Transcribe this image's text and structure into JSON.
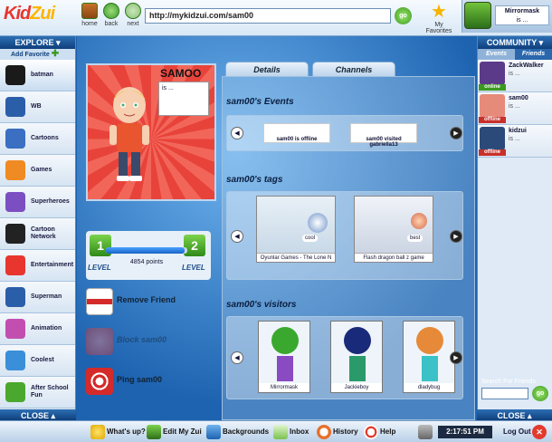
{
  "app": {
    "logo_a": "Kid",
    "logo_b": "Zui"
  },
  "nav": {
    "home": "home",
    "back": "back",
    "next": "next"
  },
  "url": "http://mykidzui.com/sam00",
  "go": "go",
  "favorites": "My Favorites",
  "user": {
    "name": "Mirrormask",
    "status": "is ..."
  },
  "explore": {
    "title": "EXPLORE",
    "add_favorite": "Add Favorite",
    "items": [
      {
        "label": "batman",
        "color": "#1a1a1a"
      },
      {
        "label": "WB",
        "color": "#2b5ea8"
      },
      {
        "label": "Cartoons",
        "color": "#3a6fc2"
      },
      {
        "label": "Games",
        "color": "#f08a22"
      },
      {
        "label": "Superheroes",
        "color": "#7b4fc2"
      },
      {
        "label": "Cartoon Network",
        "color": "#222222"
      },
      {
        "label": "Entertainment",
        "color": "#e8352e"
      },
      {
        "label": "Superman",
        "color": "#2b5ea8"
      },
      {
        "label": "Animation",
        "color": "#c24fb0"
      },
      {
        "label": "Coolest",
        "color": "#3a8fd8"
      },
      {
        "label": "After School Fun",
        "color": "#4aa82e"
      }
    ],
    "close": "CLOSE"
  },
  "community": {
    "title": "COMMUNITY",
    "tabs": {
      "events": "Events",
      "friends": "Friends"
    },
    "friends": [
      {
        "name": "ZackWalker",
        "status_text": "is ...",
        "state": "online",
        "color": "#5c3a8a"
      },
      {
        "name": "sam00",
        "status_text": "is ...",
        "state": "offline",
        "color": "#e68a7a"
      },
      {
        "name": "kidzui",
        "status_text": "is ...",
        "state": "offline",
        "color": "#2b4a7a"
      }
    ],
    "search_label": "Search For Friends",
    "go": "go",
    "close": "CLOSE"
  },
  "profile": {
    "name": "SAMOO",
    "status": "is ...",
    "level_left": "1",
    "level_right": "2",
    "level_word": "LEVEL",
    "points": "4854 points",
    "progress_fraction": 0.97,
    "actions": {
      "remove_friend": "Remove Friend",
      "block": "Block sam00",
      "ping": "Ping sam00"
    }
  },
  "tabs": {
    "details": "Details",
    "channels": "Channels"
  },
  "events": {
    "title": "sam00's Events",
    "items": [
      "sam00 is offline",
      "sam00 visited gabriella13"
    ]
  },
  "tags": {
    "title": "sam00's tags",
    "items": [
      {
        "caption": "Oyunlar Games - The Lone N",
        "sticker": "cool"
      },
      {
        "caption": "Flash dragon ball z game",
        "sticker": "best"
      }
    ]
  },
  "visitors": {
    "title": "sam00's visitors",
    "items": [
      {
        "name": "Mirrormask",
        "color": "#3aa82e"
      },
      {
        "name": "Jackieboy",
        "color": "#2a4fb0"
      },
      {
        "name": "dladybug",
        "color": "#e68a3a"
      }
    ]
  },
  "bottom": {
    "whats_up": "What's up?",
    "edit": "Edit My Zui",
    "backgrounds": "Backgrounds",
    "inbox": "Inbox",
    "history": "History",
    "help": "Help",
    "time": "2:17:51 PM",
    "logout": "Log Out"
  }
}
